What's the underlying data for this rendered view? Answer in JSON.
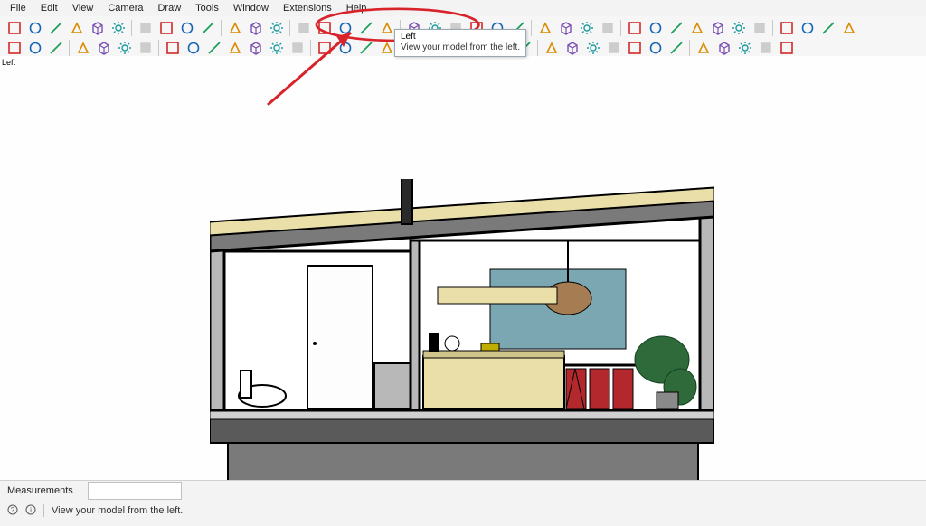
{
  "menu": {
    "items": [
      "File",
      "Edit",
      "View",
      "Camera",
      "Draw",
      "Tools",
      "Window",
      "Extensions",
      "Help"
    ]
  },
  "toolbar_row1_names": [
    "select-tool-icon",
    "eraser-tool-icon",
    "line-tool-icon",
    "dimension-tool-icon",
    "paint-bucket-icon",
    "text-tool-icon",
    "arc-tool-icon",
    "pie-tool-icon",
    "axes-icon",
    "extension-warehouse-icon",
    "component-icon",
    "copy-component-icon",
    "zoom-extents-icon",
    "pan-tool-icon",
    "orbit-icon",
    "walk-icon",
    "previous-view-icon",
    "section-plane-icon",
    "iso-view-icon",
    "top-view-icon",
    "front-view-icon",
    "right-view-icon",
    "back-view-icon",
    "left-view-icon",
    "style-toggle-a-icon",
    "style-toggle-b-icon",
    "style-toggle-c-icon",
    "style-toggle-d-icon",
    "solid-union-icon",
    "solid-subtract-icon",
    "solid-trim-icon",
    "solid-intersect-icon",
    "solid-split-icon",
    "shell-a-icon",
    "shell-b-icon",
    "section-a-icon",
    "section-b-icon",
    "section-c-icon",
    "section-d-icon"
  ],
  "toolbar_row2_names": [
    "zoom-tool-icon",
    "select-arrow-icon",
    "select-lasso-icon",
    "erase-guides-icon",
    "line-from-point-icon",
    "rectangle-icon",
    "rotated-rect-icon",
    "outer-shell-icon",
    "intersect-faces-icon",
    "target-icon",
    "axes-red-icon",
    "smoove-icon",
    "offset-icon",
    "warning-icon",
    "screen-text-icon",
    "leader-text-icon",
    "vertical-text-icon",
    "horizontal-text-icon",
    "tag-icon",
    "profile-icon",
    "toolbox-icon",
    "tape-measure-icon",
    "ruler-icon",
    "pencil-icon",
    "dimension-line-icon",
    "protractor-icon",
    "arrow-yellow-icon",
    "scale-icon",
    "grid-icon",
    "push-pull-icon",
    "follow-me-icon",
    "paint-roller-icon",
    "weld-icon",
    "curviloft-icon",
    "plugin-a-icon",
    "plugin-b-icon"
  ],
  "viewport": {
    "label": "Left"
  },
  "tooltip": {
    "title": "Left",
    "body": "View your model from the left."
  },
  "status": {
    "measurements_label": "Measurements",
    "measurement_value": "",
    "hint": "View your model from the left."
  }
}
